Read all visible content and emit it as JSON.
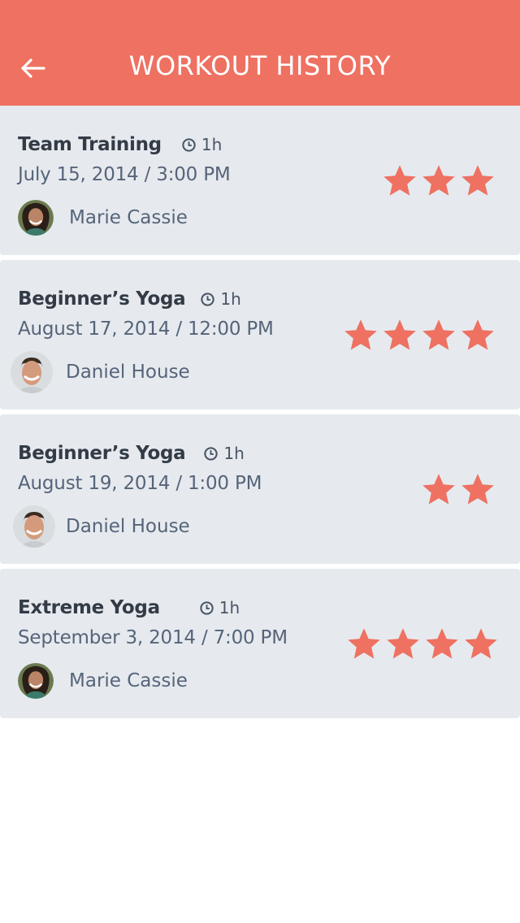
{
  "header": {
    "title": "WORKOUT HISTORY",
    "back_icon": "arrow-left-icon"
  },
  "colors": {
    "accent": "#ee7162",
    "card_bg": "#e6eaee",
    "title_text": "#333b46",
    "secondary_text": "#56647a",
    "star": "#ee7162"
  },
  "workouts": [
    {
      "name": "Team Training",
      "duration": "1h",
      "date_time": "July 15, 2014  /  3:00 PM",
      "trainer": "Marie Cassie",
      "rating": 3
    },
    {
      "name": "Beginner’s Yoga",
      "duration": "1h",
      "date_time": "August 17, 2014  /  12:00 PM",
      "trainer": "Daniel House",
      "rating": 4
    },
    {
      "name": "Beginner’s Yoga",
      "duration": "1h",
      "date_time": "August 19, 2014  /  1:00 PM",
      "trainer": "Daniel House",
      "rating": 2
    },
    {
      "name": "Extreme Yoga",
      "duration": "1h",
      "date_time": "September 3, 2014  / 7:00 PM",
      "trainer": "Marie Cassie",
      "rating": 4
    }
  ]
}
